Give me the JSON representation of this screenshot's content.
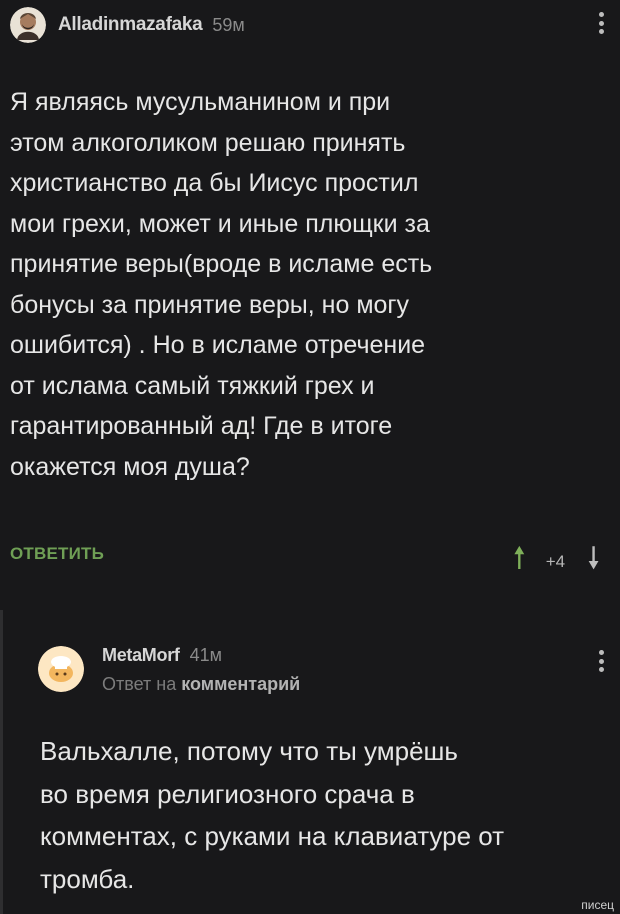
{
  "post": {
    "author": "Alladinmazafaka",
    "time": "59м",
    "text": "Я являясь мусульманином и при\nэтом алкоголиком решаю принять\nхристианство да бы Иисус простил\nмои грехи, может и иные плющки за\nпринятие веры(вроде в исламе есть\nбонусы за принятие веры, но могу\nошибится) . Но в исламе отречение\nот ислама самый тяжкий грех и\nгарантированный ад! Где в итоге\nокажется моя душа?",
    "reply_label": "ОТВЕТИТЬ",
    "score": "+4",
    "up_icon": "arrow-up-icon",
    "down_icon": "arrow-down-icon"
  },
  "reply": {
    "author": "MetaMorf",
    "time": "41м",
    "reply_prefix": "Ответ на",
    "reply_target": "комментарий",
    "text": "Вальхалле, потому что ты умрёшь\nво время религиозного срача в\nкомментах, с руками на клавиатуре от\nтромба."
  },
  "watermark": "писец",
  "colors": {
    "background": "#18181a",
    "accent": "#6f9f55",
    "text": "#e4e4e4"
  }
}
